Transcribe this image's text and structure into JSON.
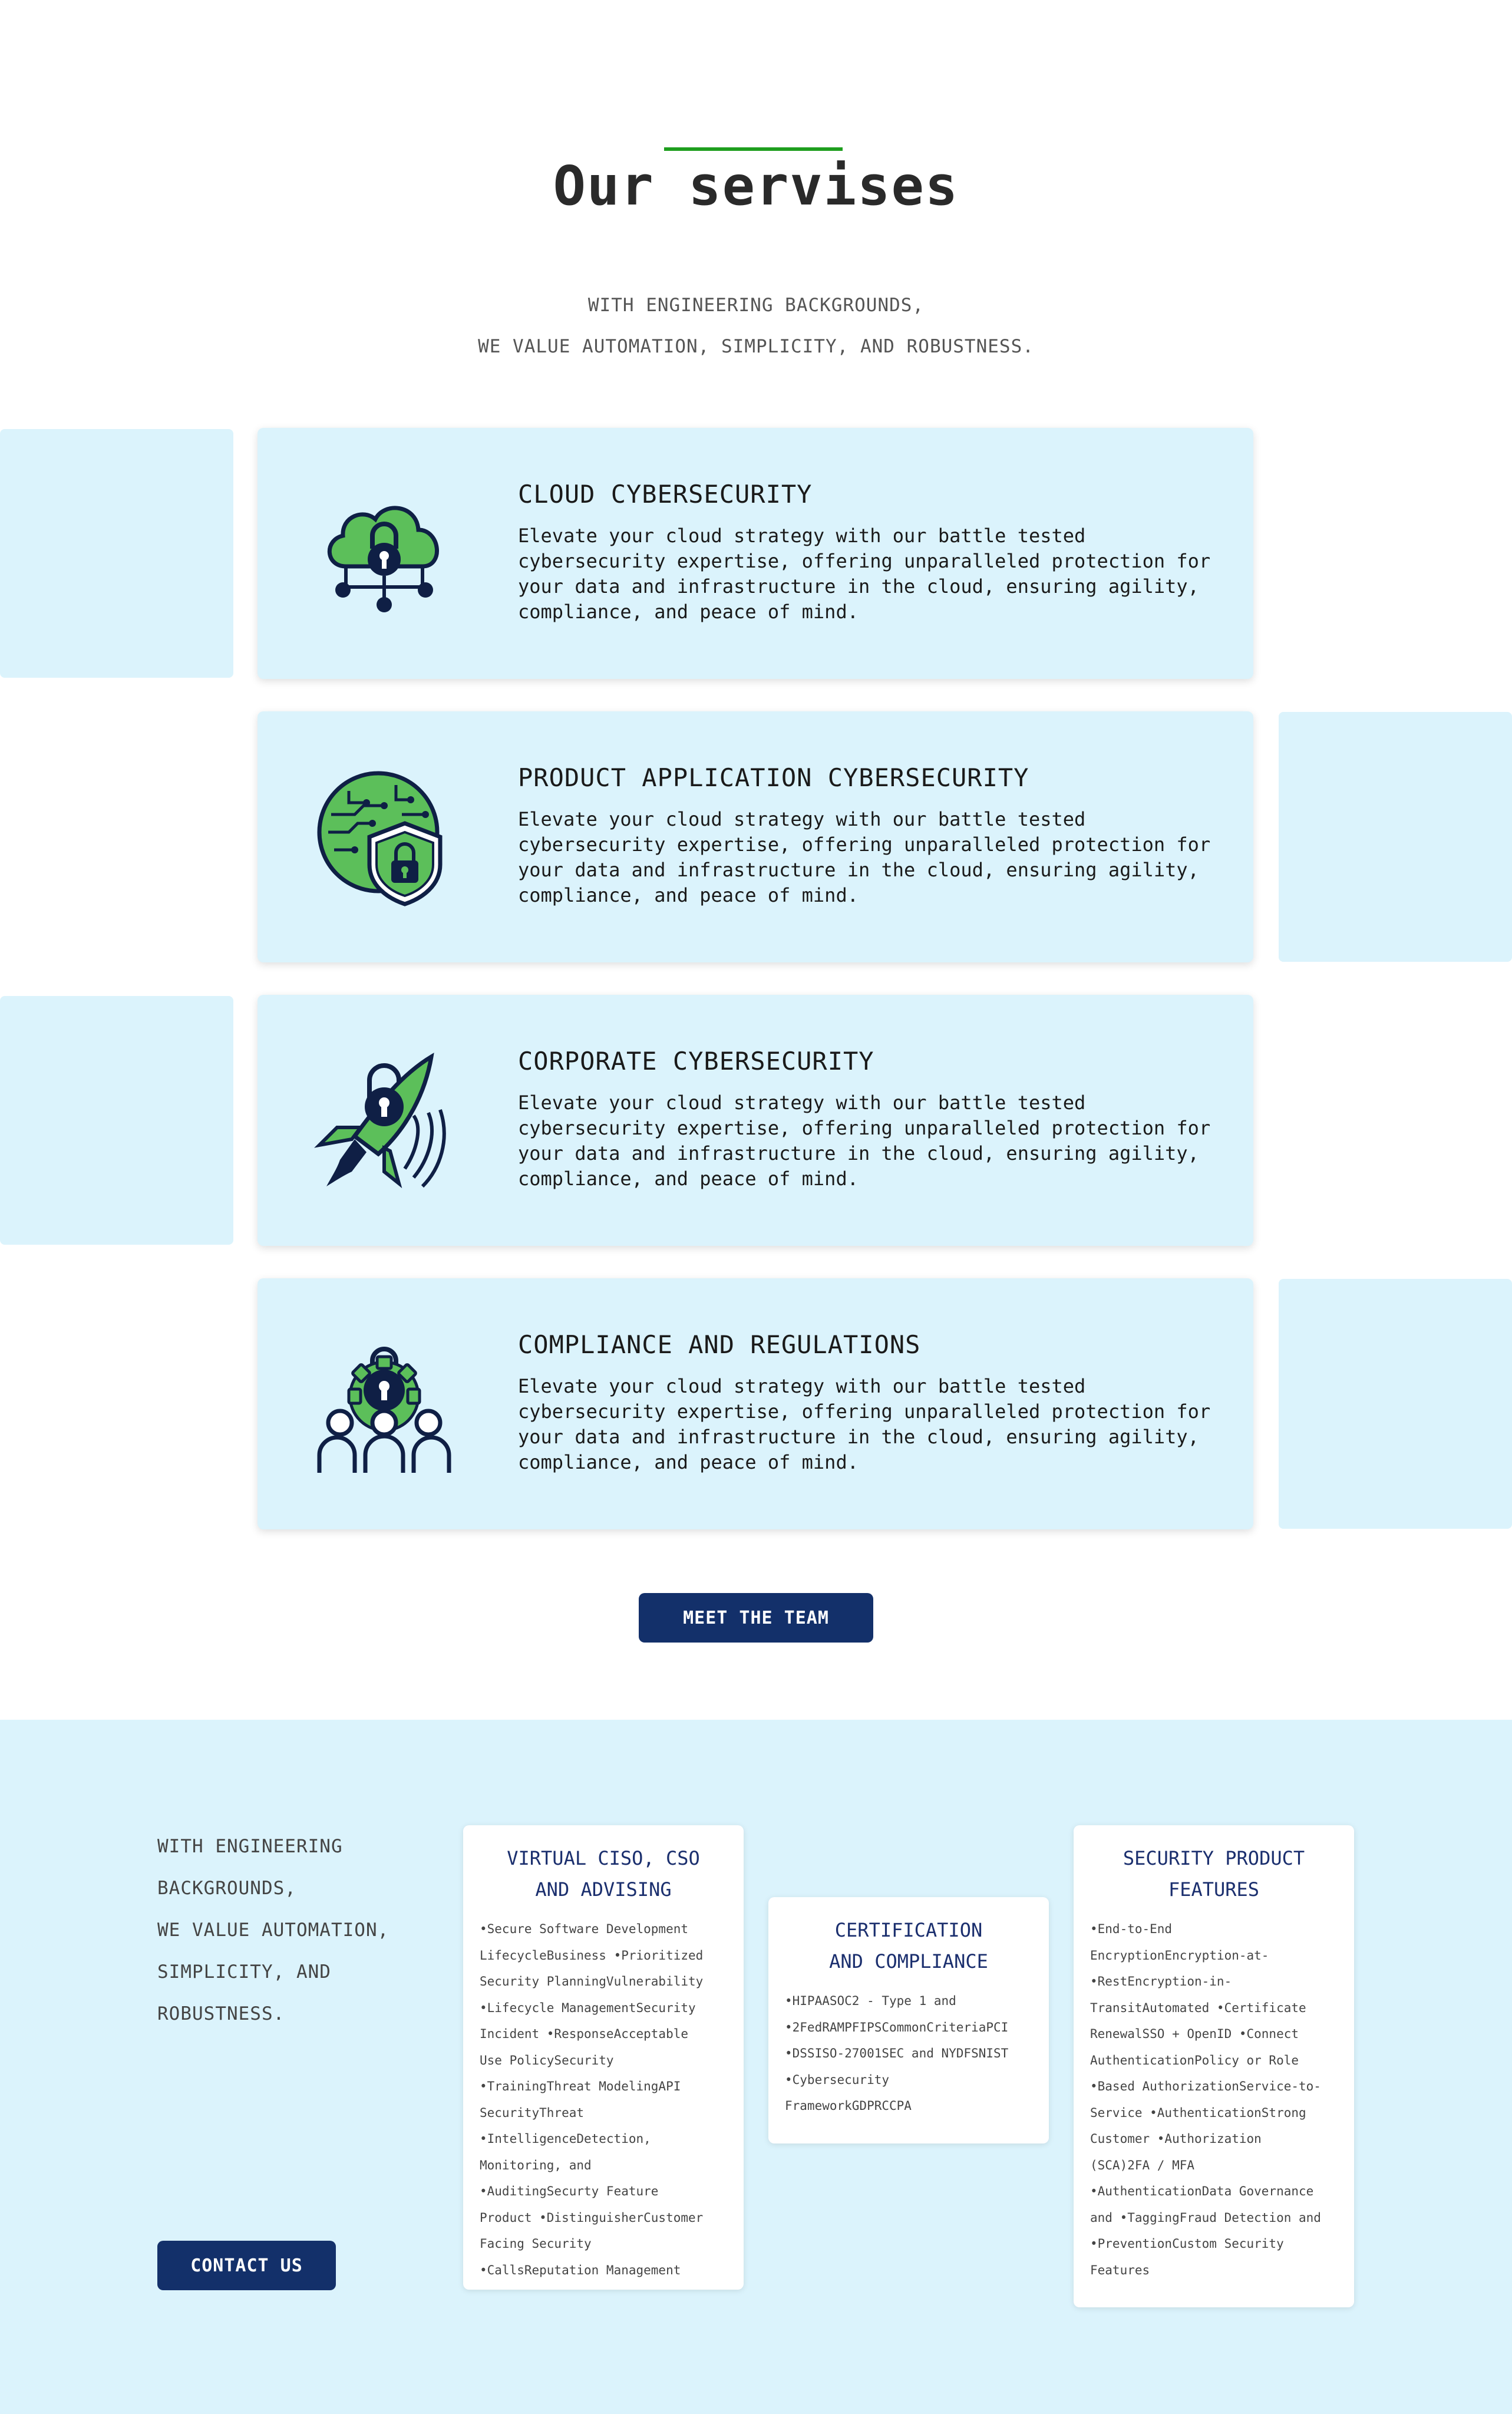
{
  "header": {
    "title": "Our servises",
    "subtitle_line1": "WITH ENGINEERING BACKGROUNDS,",
    "subtitle_line2": "WE VALUE AUTOMATION, SIMPLICITY, AND ROBUSTNESS."
  },
  "services": [
    {
      "icon": "cloud-lock-icon",
      "title": "CLOUD CYBERSECURITY",
      "text": "Elevate your cloud strategy with our battle tested cybersecurity expertise, offering unparalleled protection for your data and infrastructure in the cloud, ensuring agility, compliance, and peace of mind."
    },
    {
      "icon": "shield-lock-circuit-icon",
      "title": "PRODUCT APPLICATION CYBERSECURITY",
      "text": "Elevate your cloud strategy with our battle tested cybersecurity expertise, offering unparalleled protection for your data and infrastructure in the cloud, ensuring agility, compliance, and peace of mind."
    },
    {
      "icon": "rocket-lock-icon",
      "title": "CORPORATE CYBERSECURITY",
      "text": "Elevate your cloud strategy with our battle tested cybersecurity expertise, offering unparalleled protection for your data and infrastructure in the cloud, ensuring agility, compliance, and peace of mind."
    },
    {
      "icon": "team-gear-lock-icon",
      "title": "COMPLIANCE AND REGULATIONS",
      "text": "Elevate your cloud strategy with our battle tested cybersecurity expertise, offering unparalleled protection for your data and infrastructure in the cloud, ensuring agility, compliance, and peace of mind."
    }
  ],
  "meet_team_button": "MEET THE TEAM",
  "footer": {
    "text_lines": [
      "WITH ENGINEERING",
      "BACKGROUNDS,",
      "WE VALUE AUTOMATION,",
      "SIMPLICITY, AND",
      "ROBUSTNESS."
    ],
    "contact_button": "CONTACT US",
    "cards": [
      {
        "title_line1": "VIRTUAL CISO, CSO",
        "title_line2": "AND ADVISING",
        "lines": [
          "•Secure Software Development",
          "LifecycleBusiness •Prioritized",
          "Security PlanningVulnerability",
          "•Lifecycle ManagementSecurity",
          "Incident •ResponseAcceptable",
          "Use PolicySecurity",
          "•TrainingThreat ModelingAPI",
          "SecurityThreat",
          "•IntelligenceDetection,",
          "Monitoring, and",
          "•AuditingSecurty Feature",
          "Product •DistinguisherCustomer",
          "Facing Security",
          "•CallsReputation Management"
        ]
      },
      {
        "title_line1": "CERTIFICATION",
        "title_line2": "AND COMPLIANCE",
        "lines": [
          "•HIPAASOC2 - Type 1 and",
          "•2FedRAMPFIPSCommonCriteriaPCI",
          "•DSSISO-27001SEC and NYDFSNIST",
          "•Cybersecurity",
          "FrameworkGDPRCCPA"
        ]
      },
      {
        "title_line1": "SECURITY PRODUCT",
        "title_line2": "FEATURES",
        "lines": [
          "•End-to-End",
          "EncryptionEncryption-at-",
          "•RestEncryption-in-",
          "TransitAutomated •Certificate",
          "RenewalSSO + OpenID •Connect",
          "AuthenticationPolicy or Role",
          "•Based AuthorizationService-to-",
          "Service •AuthenticationStrong",
          "Customer •Authorization",
          "(SCA)2FA / MFA",
          "•AuthenticationData Governance",
          "and •TaggingFraud Detection and",
          "•PreventionCustom Security",
          "Features"
        ]
      }
    ]
  },
  "colors": {
    "accent_green": "#1e9e1e",
    "icon_green": "#5cbf5a",
    "navy": "#13306a",
    "card_bg": "#dbf3fc"
  }
}
